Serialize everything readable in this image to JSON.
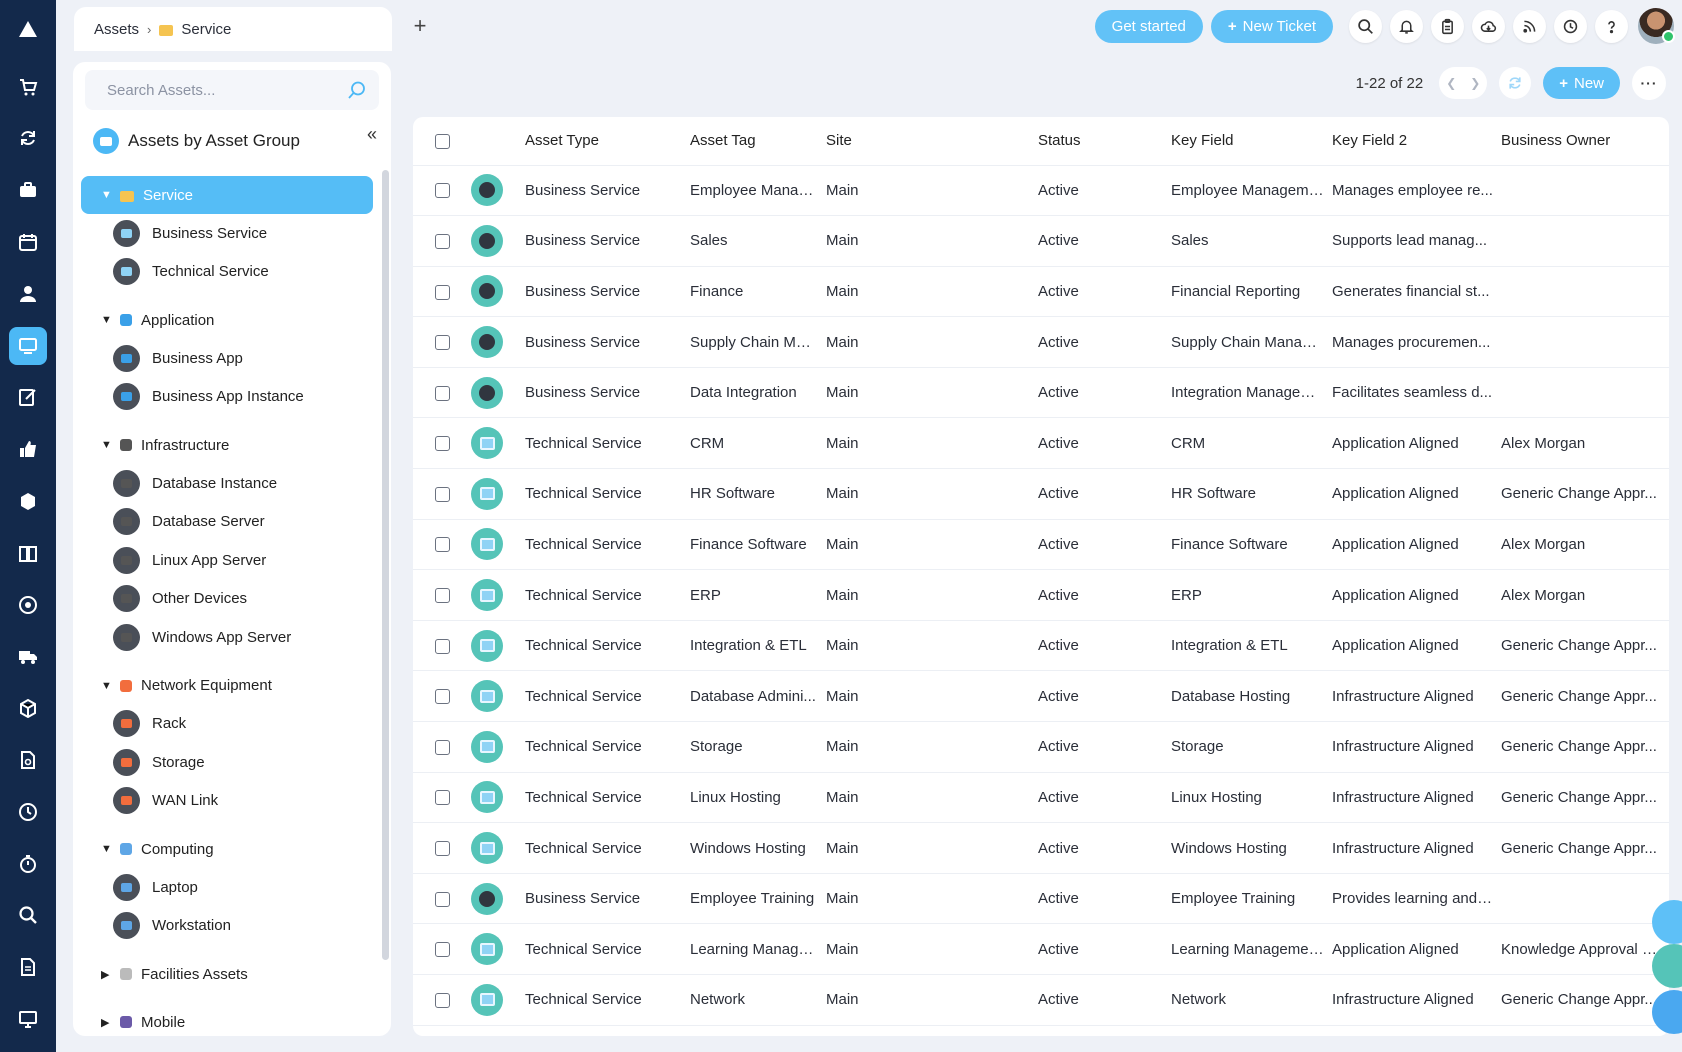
{
  "rail": {
    "icons": [
      "alert-icon",
      "cart-icon",
      "sync-icon",
      "briefcase-icon",
      "calendar-icon",
      "user-icon",
      "monitor-icon",
      "edit-icon",
      "thumbs-up-icon",
      "boxes-icon",
      "book-icon",
      "disc-icon",
      "truck-icon",
      "package-icon",
      "file-search-icon",
      "clock-icon",
      "timer-icon",
      "search-icon",
      "document-icon",
      "display-icon"
    ],
    "active_index": 6
  },
  "header": {
    "breadcrumb_root": "Assets",
    "breadcrumb_current": "Service",
    "get_started": "Get started",
    "new_ticket": "New Ticket"
  },
  "sidebar": {
    "search_placeholder": "Search Assets...",
    "title": "Assets by Asset Group",
    "collapse_glyph": "«",
    "selected": "Service",
    "service_children": [
      "Business Service",
      "Technical Service"
    ],
    "groups": [
      {
        "label": "Application",
        "expanded": true,
        "color": "#3aa0e8",
        "children": [
          "Business App",
          "Business App Instance"
        ]
      },
      {
        "label": "Infrastructure",
        "expanded": true,
        "color": "#555555",
        "children": [
          "Database Instance",
          "Database Server",
          "Linux App Server",
          "Other Devices",
          "Windows App Server"
        ]
      },
      {
        "label": "Network Equipment",
        "expanded": true,
        "color": "#f26d3d",
        "children": [
          "Rack",
          "Storage",
          "WAN Link"
        ]
      },
      {
        "label": "Computing",
        "expanded": true,
        "color": "#5ea6e6",
        "children": [
          "Laptop",
          "Workstation"
        ]
      },
      {
        "label": "Facilities Assets",
        "expanded": false,
        "color": "#bbbbbb",
        "children": []
      },
      {
        "label": "Mobile",
        "expanded": false,
        "color": "#6b5aa8",
        "children": []
      }
    ]
  },
  "pager": {
    "range": "1-22",
    "of": "of",
    "total": "22",
    "new_label": "New"
  },
  "table": {
    "columns": [
      "Asset Type",
      "Asset Tag",
      "Site",
      "Status",
      "Key Field",
      "Key Field 2",
      "Business Owner"
    ],
    "rows": [
      {
        "kind": "biz",
        "type": "Business Service",
        "tag": "Employee Manag...",
        "site": "Main",
        "status": "Active",
        "key": "Employee Management",
        "key2": "Manages employee re...",
        "owner": ""
      },
      {
        "kind": "biz",
        "type": "Business Service",
        "tag": "Sales",
        "site": "Main",
        "status": "Active",
        "key": "Sales",
        "key2": "Supports lead manag...",
        "owner": ""
      },
      {
        "kind": "biz",
        "type": "Business Service",
        "tag": "Finance",
        "site": "Main",
        "status": "Active",
        "key": "Financial Reporting",
        "key2": "Generates financial st...",
        "owner": ""
      },
      {
        "kind": "biz",
        "type": "Business Service",
        "tag": "Supply Chain Ma...",
        "site": "Main",
        "status": "Active",
        "key": "Supply Chain Manage...",
        "key2": "Manages procuremen...",
        "owner": ""
      },
      {
        "kind": "biz",
        "type": "Business Service",
        "tag": "Data Integration",
        "site": "Main",
        "status": "Active",
        "key": "Integration Managem...",
        "key2": "Facilitates seamless d...",
        "owner": ""
      },
      {
        "kind": "tech",
        "type": "Technical Service",
        "tag": "CRM",
        "site": "Main",
        "status": "Active",
        "key": "CRM",
        "key2": "Application Aligned",
        "owner": "Alex Morgan"
      },
      {
        "kind": "tech",
        "type": "Technical Service",
        "tag": "HR Software",
        "site": "Main",
        "status": "Active",
        "key": "HR Software",
        "key2": "Application Aligned",
        "owner": "Generic Change Appr..."
      },
      {
        "kind": "tech",
        "type": "Technical Service",
        "tag": "Finance Software",
        "site": "Main",
        "status": "Active",
        "key": "Finance Software",
        "key2": "Application Aligned",
        "owner": "Alex Morgan"
      },
      {
        "kind": "tech",
        "type": "Technical Service",
        "tag": "ERP",
        "site": "Main",
        "status": "Active",
        "key": "ERP",
        "key2": "Application Aligned",
        "owner": "Alex Morgan"
      },
      {
        "kind": "tech",
        "type": "Technical Service",
        "tag": "Integration & ETL",
        "site": "Main",
        "status": "Active",
        "key": "Integration & ETL",
        "key2": "Application Aligned",
        "owner": "Generic Change Appr..."
      },
      {
        "kind": "tech",
        "type": "Technical Service",
        "tag": "Database Admini...",
        "site": "Main",
        "status": "Active",
        "key": "Database Hosting",
        "key2": "Infrastructure Aligned",
        "owner": "Generic Change Appr..."
      },
      {
        "kind": "tech",
        "type": "Technical Service",
        "tag": "Storage",
        "site": "Main",
        "status": "Active",
        "key": "Storage",
        "key2": "Infrastructure Aligned",
        "owner": "Generic Change Appr..."
      },
      {
        "kind": "tech",
        "type": "Technical Service",
        "tag": "Linux Hosting",
        "site": "Main",
        "status": "Active",
        "key": "Linux Hosting",
        "key2": "Infrastructure Aligned",
        "owner": "Generic Change Appr..."
      },
      {
        "kind": "tech",
        "type": "Technical Service",
        "tag": "Windows Hosting",
        "site": "Main",
        "status": "Active",
        "key": "Windows Hosting",
        "key2": "Infrastructure Aligned",
        "owner": "Generic Change Appr..."
      },
      {
        "kind": "biz",
        "type": "Business Service",
        "tag": "Employee Training",
        "site": "Main",
        "status": "Active",
        "key": "Employee Training",
        "key2": "Provides learning and ...",
        "owner": ""
      },
      {
        "kind": "tech",
        "type": "Technical Service",
        "tag": "Learning Manage...",
        "site": "Main",
        "status": "Active",
        "key": "Learning Management...",
        "key2": "Application Aligned",
        "owner": "Knowledge Approval G..."
      },
      {
        "kind": "tech",
        "type": "Technical Service",
        "tag": "Network",
        "site": "Main",
        "status": "Active",
        "key": "Network",
        "key2": "Infrastructure Aligned",
        "owner": "Generic Change Appr..."
      }
    ]
  },
  "colors": {
    "rail": "#13294b",
    "accent": "#4cb8f5",
    "row_icon": "#55c4b8"
  }
}
